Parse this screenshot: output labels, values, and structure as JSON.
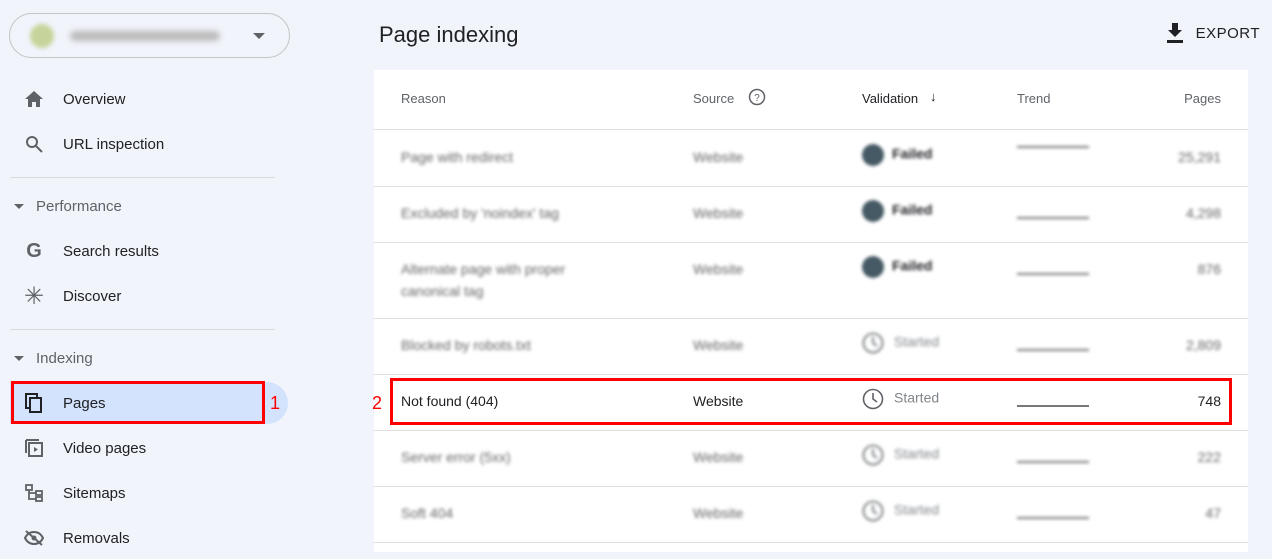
{
  "sidebar": {
    "property_selector": {
      "url": "https://www.website.com/"
    },
    "items": [
      {
        "label": "Overview",
        "icon": "home-icon"
      },
      {
        "label": "URL inspection",
        "icon": "search-icon"
      },
      {
        "label": "Search results",
        "icon": "google-g-icon"
      },
      {
        "label": "Discover",
        "icon": "asterisk-icon"
      },
      {
        "label": "Pages",
        "icon": "pages-icon",
        "active": true
      },
      {
        "label": "Video pages",
        "icon": "video-pages-icon"
      },
      {
        "label": "Sitemaps",
        "icon": "sitemap-icon"
      },
      {
        "label": "Removals",
        "icon": "eye-off-icon"
      }
    ],
    "sections": {
      "performance": "Performance",
      "indexing": "Indexing"
    }
  },
  "annotations": {
    "one": "1",
    "two": "2",
    "color": "#ff0000"
  },
  "header": {
    "title": "Page indexing",
    "export": "EXPORT"
  },
  "table": {
    "columns": {
      "reason": "Reason",
      "source": "Source",
      "validation": "Validation",
      "trend": "Trend",
      "pages": "Pages"
    },
    "rows": [
      {
        "reason": "Page with redirect",
        "source": "Website",
        "validation": "Failed",
        "pages": "25,291"
      },
      {
        "reason": "Excluded by 'noindex' tag",
        "source": "Website",
        "validation": "Failed",
        "pages": "4,298"
      },
      {
        "reason": "Alternate page with proper canonical tag",
        "source": "Website",
        "validation": "Failed",
        "pages": "876"
      },
      {
        "reason": "Blocked by robots.txt",
        "source": "Website",
        "validation": "Started",
        "pages": "2,809"
      },
      {
        "reason": "Not found (404)",
        "source": "Website",
        "validation": "Started",
        "pages": "748"
      },
      {
        "reason": "Server error (5xx)",
        "source": "Website",
        "validation": "Started",
        "pages": "222"
      },
      {
        "reason": "Soft 404",
        "source": "Website",
        "validation": "Started",
        "pages": "47"
      }
    ]
  }
}
